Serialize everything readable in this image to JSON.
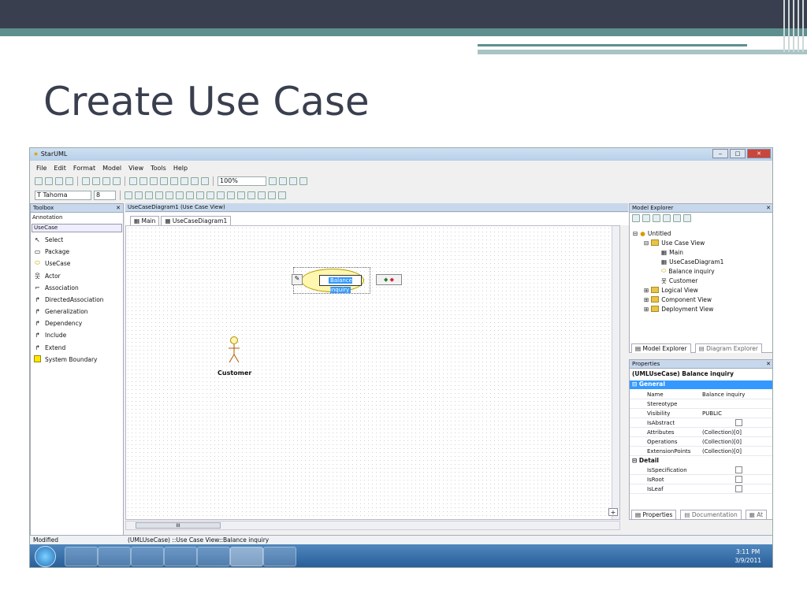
{
  "slide": {
    "title": "Create Use Case"
  },
  "window": {
    "app_title": "StarUML"
  },
  "menu": [
    "File",
    "Edit",
    "Format",
    "Model",
    "View",
    "Tools",
    "Help"
  ],
  "toolbar": {
    "zoom": "100%",
    "font_name": "Tahoma",
    "font_size": "8"
  },
  "toolbox": {
    "title": "Toolbox",
    "annotation": "Annotation",
    "section": "UseCase",
    "items": [
      "Select",
      "Package",
      "UseCase",
      "Actor",
      "Association",
      "DirectedAssociation",
      "Generalization",
      "Dependency",
      "Include",
      "Extend",
      "System Boundary"
    ]
  },
  "diagram": {
    "header": "UseCaseDiagram1 (Use Case View)",
    "tabs": [
      "Main",
      "UseCaseDiagram1"
    ],
    "usecase_label": "Balance inquiry",
    "actor_label": "Customer",
    "scroll_thumb": "III"
  },
  "explorer": {
    "title": "Model Explorer",
    "tree": [
      "Untitled",
      "Use Case View",
      "Main",
      "UseCaseDiagram1",
      "Balance inquiry",
      "Customer",
      "Logical View",
      "Component View",
      "Deployment View"
    ],
    "tabs": [
      "Model Explorer",
      "Diagram Explorer"
    ]
  },
  "properties": {
    "title": "Properties",
    "header": "(UMLUseCase) Balance inquiry",
    "general": "General",
    "rows": [
      {
        "key": "Name",
        "value": "Balance inquiry"
      },
      {
        "key": "Stereotype",
        "value": ""
      },
      {
        "key": "Visibility",
        "value": "PUBLIC"
      },
      {
        "key": "IsAbstract",
        "value": ""
      },
      {
        "key": "Attributes",
        "value": "(Collection)[0]"
      },
      {
        "key": "Operations",
        "value": "(Collection)[0]"
      },
      {
        "key": "ExtensionPoints",
        "value": "(Collection)[0]"
      }
    ],
    "detail": "Detail",
    "detail_rows": [
      {
        "key": "IsSpecification"
      },
      {
        "key": "IsRoot"
      },
      {
        "key": "IsLeaf"
      }
    ],
    "tabs": [
      "Properties",
      "Documentation",
      "At"
    ]
  },
  "status": {
    "left": "Modified",
    "path": "(UMLUseCase) ::Use Case View::Balance inquiry"
  },
  "taskbar": {
    "time": "3:11 PM",
    "date": "3/9/2011"
  },
  "colors": {
    "topbar": "#3a3f4f",
    "accent": "#5e8f8f",
    "selection": "#3399ff"
  }
}
